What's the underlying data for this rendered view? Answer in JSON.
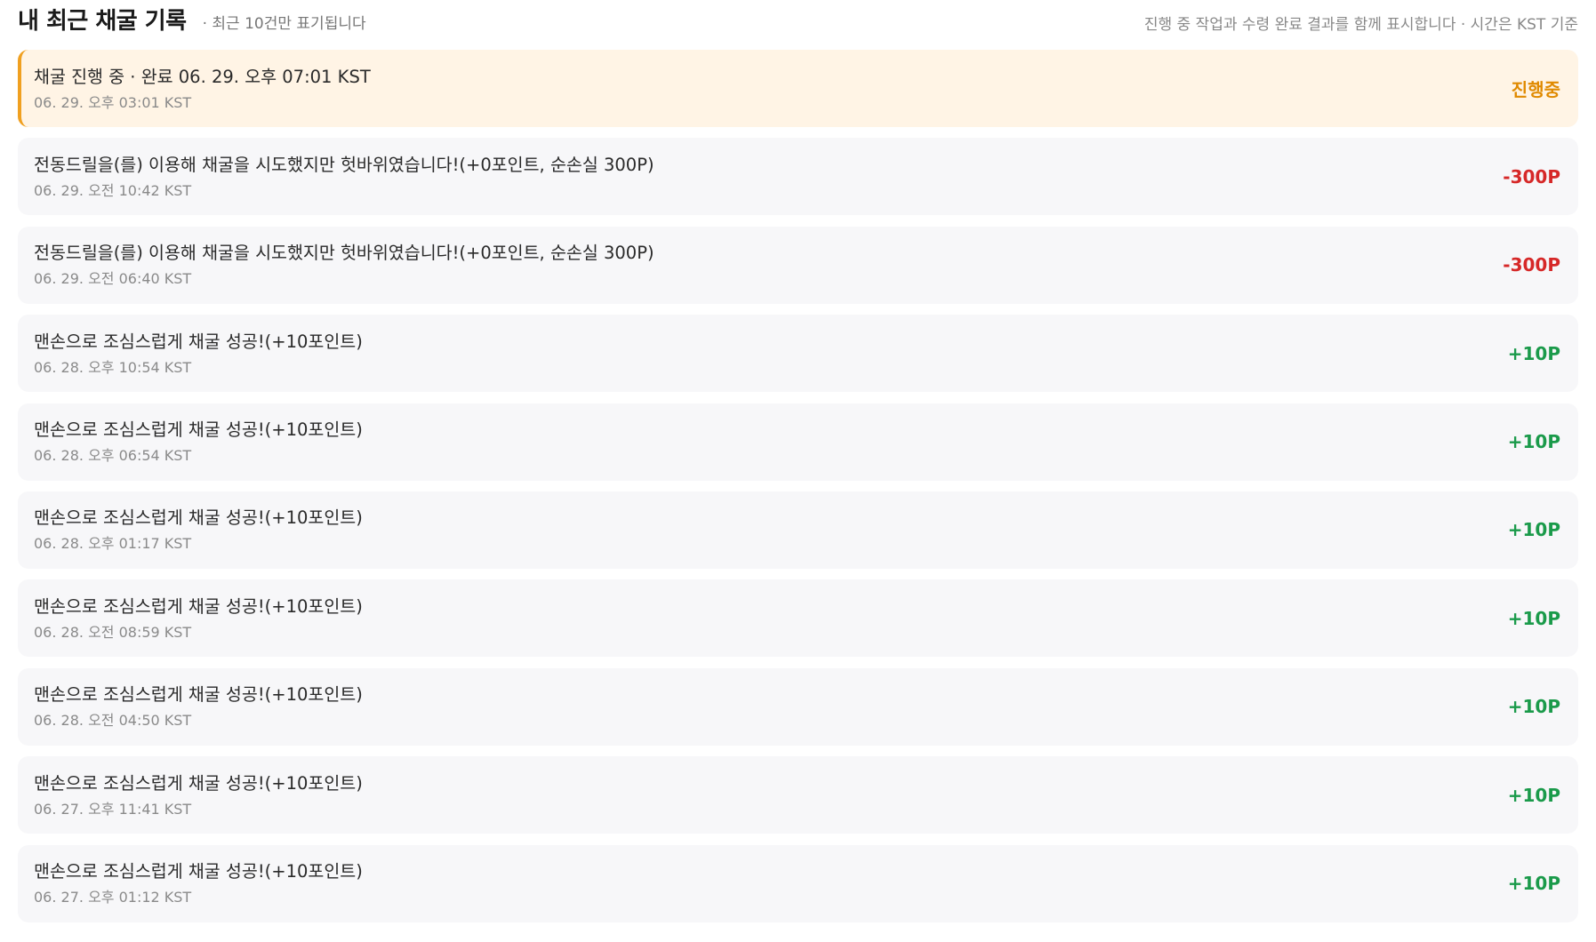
{
  "header": {
    "title": "내 최근 채굴 기록",
    "subtitle": "· 최근 10건만 표기됩니다",
    "note": "진행 중 작업과 수령 완료 결과를 함께 표시합니다 · 시간은 KST 기준"
  },
  "colors": {
    "progress": "#e08a00",
    "negative": "#d62828",
    "positive": "#1a9a4a",
    "active_bg": "#fff4e5",
    "active_border": "#f0a020"
  },
  "records": [
    {
      "title": "채굴 진행 중 · 완료 06. 29. 오후 07:01 KST",
      "time": "06. 29. 오후 03:01 KST",
      "amount": "진행중",
      "kind": "progress"
    },
    {
      "title": "전동드릴을(를) 이용해 채굴을 시도했지만 헛바위였습니다!(+0포인트, 순손실 300P)",
      "time": "06. 29. 오전 10:42 KST",
      "amount": "-300P",
      "kind": "neg"
    },
    {
      "title": "전동드릴을(를) 이용해 채굴을 시도했지만 헛바위였습니다!(+0포인트, 순손실 300P)",
      "time": "06. 29. 오전 06:40 KST",
      "amount": "-300P",
      "kind": "neg"
    },
    {
      "title": "맨손으로 조심스럽게 채굴 성공!(+10포인트)",
      "time": "06. 28. 오후 10:54 KST",
      "amount": "+10P",
      "kind": "pos"
    },
    {
      "title": "맨손으로 조심스럽게 채굴 성공!(+10포인트)",
      "time": "06. 28. 오후 06:54 KST",
      "amount": "+10P",
      "kind": "pos"
    },
    {
      "title": "맨손으로 조심스럽게 채굴 성공!(+10포인트)",
      "time": "06. 28. 오후 01:17 KST",
      "amount": "+10P",
      "kind": "pos"
    },
    {
      "title": "맨손으로 조심스럽게 채굴 성공!(+10포인트)",
      "time": "06. 28. 오전 08:59 KST",
      "amount": "+10P",
      "kind": "pos"
    },
    {
      "title": "맨손으로 조심스럽게 채굴 성공!(+10포인트)",
      "time": "06. 28. 오전 04:50 KST",
      "amount": "+10P",
      "kind": "pos"
    },
    {
      "title": "맨손으로 조심스럽게 채굴 성공!(+10포인트)",
      "time": "06. 27. 오후 11:41 KST",
      "amount": "+10P",
      "kind": "pos"
    },
    {
      "title": "맨손으로 조심스럽게 채굴 성공!(+10포인트)",
      "time": "06. 27. 오후 01:12 KST",
      "amount": "+10P",
      "kind": "pos"
    }
  ]
}
